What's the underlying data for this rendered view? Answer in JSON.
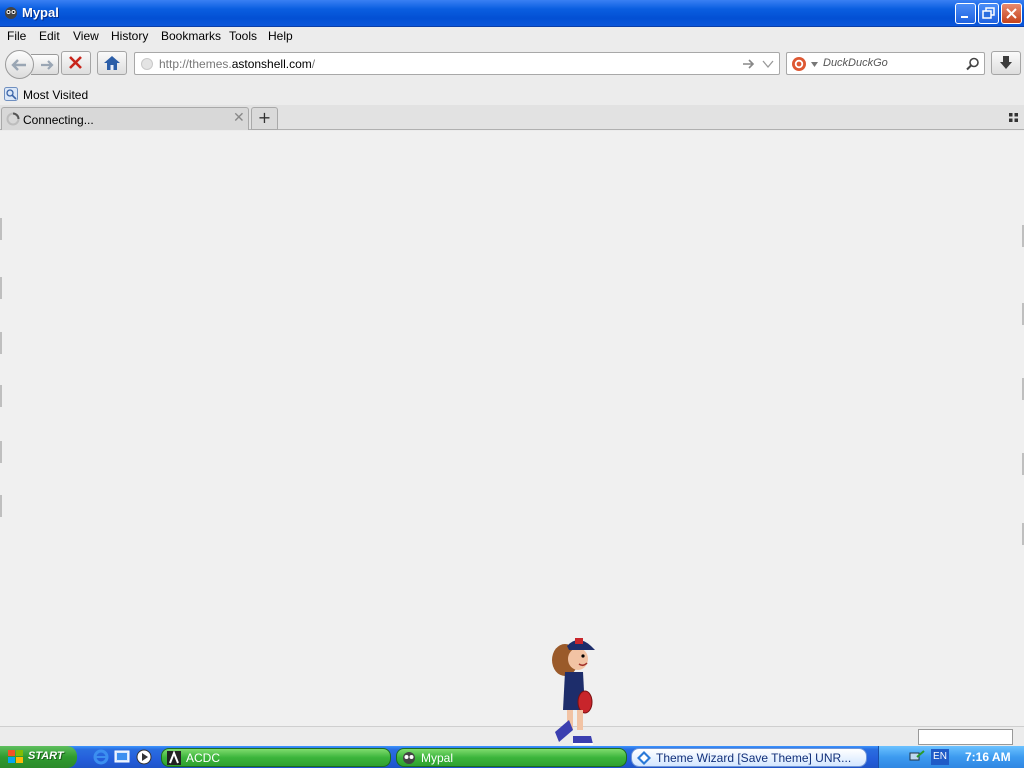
{
  "window": {
    "title": "Mypal"
  },
  "menu": [
    "File",
    "Edit",
    "View",
    "History",
    "Bookmarks",
    "Tools",
    "Help"
  ],
  "navigation": {
    "url_scheme": "http://themes.",
    "url_domain": "astonshell.com",
    "url_path": "/",
    "search_placeholder": "DuckDuckGo"
  },
  "bookmarks": {
    "most_visited": "Most Visited"
  },
  "tabs": [
    {
      "label": "Connecting..."
    }
  ],
  "taskbar": {
    "start_label": "START",
    "tasks": [
      {
        "label": "ACDC"
      },
      {
        "label": "Mypal"
      },
      {
        "label": "Theme Wizard [Save Theme]   UNR..."
      }
    ],
    "language": "EN",
    "clock": "7:16 AM"
  },
  "colors": {
    "titlebar": "#0350d4",
    "taskbar": "#245edb",
    "task_active": "#3cb53c",
    "tray": "#3d9bf0"
  }
}
